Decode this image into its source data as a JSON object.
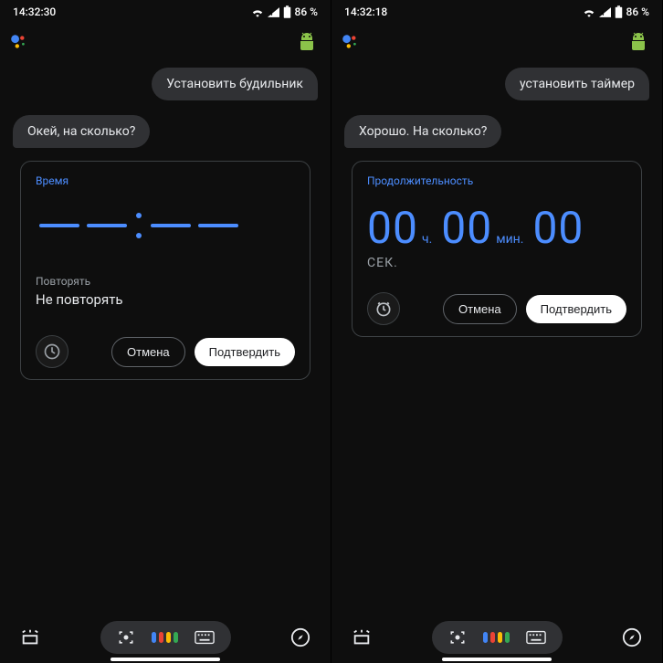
{
  "left": {
    "status": {
      "time": "14:32:30",
      "battery": "86 %"
    },
    "user_query": "Установить будильник",
    "assistant_reply": "Окей, на сколько?",
    "card": {
      "label": "Время",
      "repeat_label": "Повторять",
      "repeat_value": "Не повторять",
      "cancel": "Отмена",
      "confirm": "Подтвердить"
    }
  },
  "right": {
    "status": {
      "time": "14:32:18",
      "battery": "86 %"
    },
    "user_query": "установить таймер",
    "assistant_reply": "Хорошо. На сколько?",
    "card": {
      "label": "Продолжительность",
      "hours": "00",
      "hours_unit": "ч.",
      "minutes": "00",
      "minutes_unit": "мин.",
      "seconds": "00",
      "seconds_unit": "СЕК.",
      "cancel": "Отмена",
      "confirm": "Подтвердить"
    }
  }
}
